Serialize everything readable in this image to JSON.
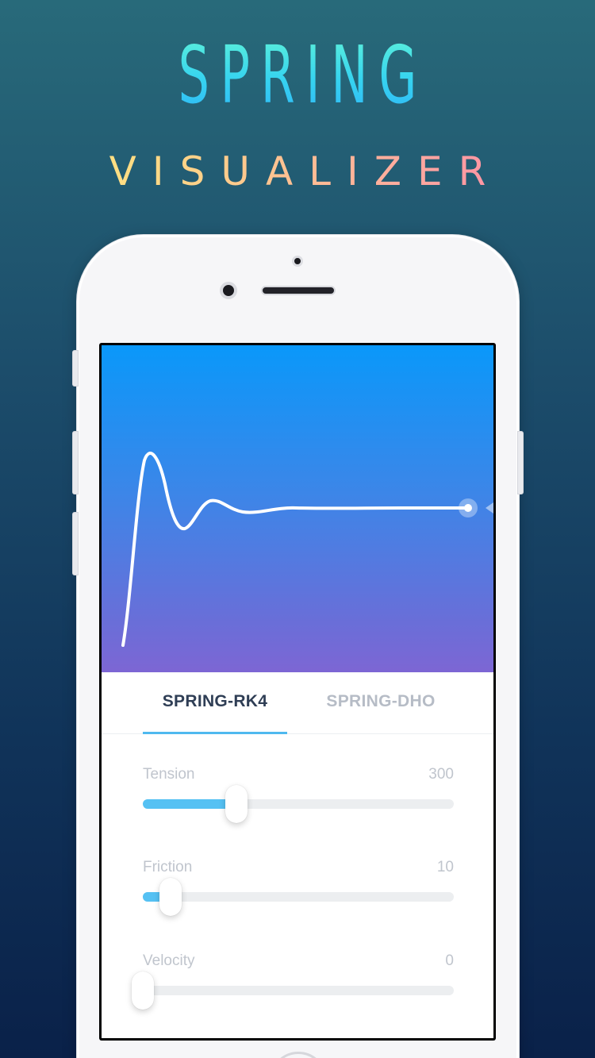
{
  "headline": {
    "title": "SPRING",
    "subtitle": "VISUALIZER"
  },
  "tabs": [
    {
      "label": "SPRING-RK4",
      "active": true
    },
    {
      "label": "SPRING-DHO",
      "active": false
    }
  ],
  "sliders": {
    "tension": {
      "label": "Tension",
      "value": "300",
      "fill_fraction": 0.3
    },
    "friction": {
      "label": "Friction",
      "value": "10",
      "fill_fraction": 0.09
    },
    "velocity": {
      "label": "Velocity",
      "value": "0",
      "fill_fraction": 0.0
    }
  },
  "colors": {
    "accent": "#4fb9ef",
    "graph_top": "#0a98fa",
    "graph_bottom": "#7d66d4",
    "active_tab": "#2f3e55",
    "inactive_tab": "#b6bcc6"
  }
}
